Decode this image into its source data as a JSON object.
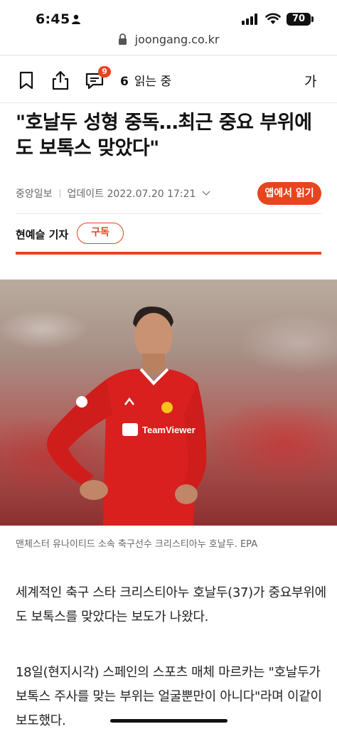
{
  "status_bar": {
    "time": "6:45",
    "battery": "70"
  },
  "browser": {
    "url": "joongang.co.kr"
  },
  "toolbar": {
    "comment_count": "9",
    "readers_count": "6",
    "readers_label": "읽는 중",
    "font_size_label": "가"
  },
  "article": {
    "headline": "\"호날두 성형 중독…최근 중요 부위에도 보톡스 맞았다\"",
    "source": "중앙일보",
    "updated": "업데이트 2022.07.20 17:21",
    "app_read_label": "앱에서 읽기",
    "reporter": "현예슬 기자",
    "subscribe_label": "구독",
    "photo_caption": "맨체스터 유나이티드 소속 축구선수 크리스티아누 호날두. EPA",
    "photo_sponsor": "TeamViewer",
    "paragraphs": [
      " 세계적인 축구 스타 크리스티아누 호날두(37)가 중요부위에도 보톡스를 맞았다는 보도가 나왔다.",
      "18일(현지시각) 스페인의 스포츠 매체 마르카는 \"호날두가 보톡스 주사를 맞는 부위는 얼굴뿐만이 아니다\"라며 이같이 보도했다."
    ]
  },
  "colors": {
    "accent": "#e8441f"
  }
}
